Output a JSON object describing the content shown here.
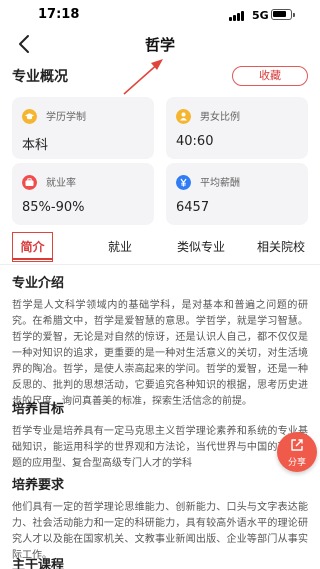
{
  "status_bar": {
    "time": "17:18",
    "network": "5G"
  },
  "nav": {
    "title": "哲学"
  },
  "overview": {
    "title": "专业概况",
    "collect_label": "收藏",
    "cards": [
      {
        "label": "学历学制",
        "value": "本科",
        "icon": "graduation-cap-icon",
        "color": "#f5b52e"
      },
      {
        "label": "男女比例",
        "value": "40:60",
        "icon": "gender-icon",
        "color": "#f5b52e"
      },
      {
        "label": "就业率",
        "value": "85%-90%",
        "icon": "briefcase-icon",
        "color": "#f04e4e"
      },
      {
        "label": "平均薪酬",
        "value": "6457",
        "icon": "yen-coin-icon",
        "color": "#2f7cf6"
      }
    ]
  },
  "tabs": [
    {
      "label": "简介",
      "active": true
    },
    {
      "label": "就业",
      "active": false
    },
    {
      "label": "类似专业",
      "active": false
    },
    {
      "label": "相关院校",
      "active": false
    }
  ],
  "sections": [
    {
      "title": "专业介绍",
      "body": "哲学是人文科学领域内的基础学科，是对基本和普遍之问题的研究。在希腊文中，哲学是爱智慧的意思。学哲学，就是学习智慧。哲学的爱智，无论是对自然的惊讶，还是认识人自己，都不仅仅是一种对知识的追求，更重要的是一种对生活意义的关切，对生活境界的陶冶。哲学，是使人崇高起来的学问。哲学的爱智，还是一种反思的、批判的思想活动，它要追究各种知识的根据，思考历史进步的尺度，询问真善美的标准，探索生活信念的前提。"
    },
    {
      "title": "培养目标",
      "body": "哲学专业是培养具有一定马克思主义哲学理论素养和系统的专业基础知识，能运用科学的世界观和方法论，当代世界与中国的现实问题的应用型、复合型高级专门人才的学科"
    },
    {
      "title": "培养要求",
      "body": "他们具有一定的哲学理论思维能力、创新能力、口头与文字表达能力、社会活动能力和一定的科研能力，具有较高外语水平的理论研究人才以及能在国家机关、文教事业新闻出版、企业等部门从事实际工作。"
    },
    {
      "title": "主干课程",
      "body": ""
    }
  ],
  "share": {
    "label": "分享"
  }
}
